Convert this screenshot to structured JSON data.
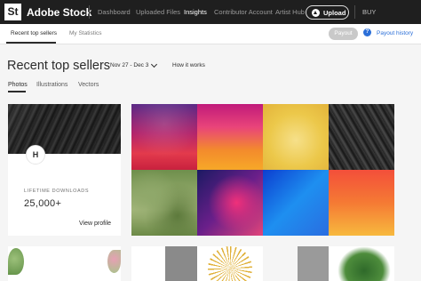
{
  "topbar": {
    "logo": "St",
    "brand": "Adobe Stock",
    "nav": [
      "Dashboard",
      "Uploaded Files",
      "Insights",
      "Contributor Account",
      "Artist Hub"
    ],
    "active_nav": "Insights",
    "upload_label": "Upload",
    "buy_label": "BUY"
  },
  "subnav": {
    "tabs": [
      "Recent top sellers",
      "My Statistics"
    ],
    "active_tab": "Recent top sellers",
    "payout_label": "Payout",
    "help_icon": "?",
    "payout_history_label": "Payout history"
  },
  "header": {
    "title": "Recent top sellers",
    "date_range": "Nov 27 - Dec 3",
    "how_it_works": "How it works"
  },
  "content_tabs": {
    "items": [
      "Photos",
      "Illustrations",
      "Vectors"
    ],
    "active": "Photos"
  },
  "profile_card": {
    "avatar_initial": "H",
    "lifetime_label": "LIFETIME DOWNLOADS",
    "lifetime_value": "25,000+",
    "view_profile": "View profile"
  },
  "icons": {
    "upload": "cloud-upload-icon",
    "date_dropdown": "chevron-down-icon",
    "help": "help-icon"
  },
  "colors": {
    "topbar_bg": "#1f1f1f",
    "accent_blue": "#2b6fd8",
    "page_bg": "#f5f5f5"
  }
}
